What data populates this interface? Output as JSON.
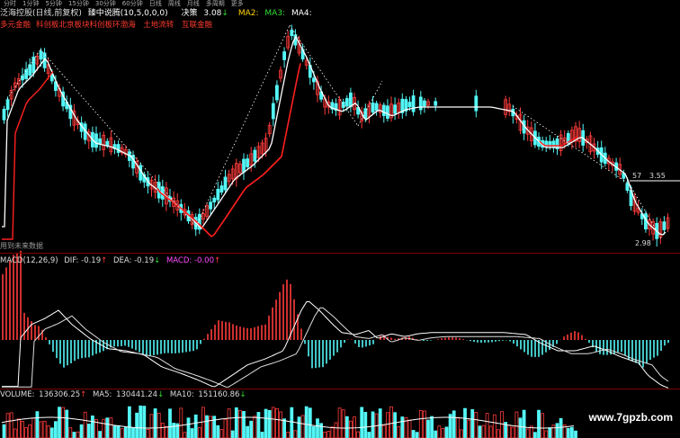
{
  "toolbar": {
    "items": [
      "分时",
      "1分钟",
      "5分钟",
      "15分钟",
      "30分钟",
      "60分钟",
      "日线",
      "周线",
      "月线",
      "多周期",
      "更多"
    ]
  },
  "header": {
    "stock_name": "泛海控股(日线,前复权)",
    "indicator": "臻中说腾(10,5,0,0,0)",
    "decision_label": "决策",
    "decision_value": "3.08",
    "decision_arrow": "↓",
    "ma2": "MA2:",
    "ma3": "MA3:",
    "ma4": "MA4:"
  },
  "concepts": [
    "多元金融",
    "科创板",
    "北京板块",
    "科创板环",
    "渤海",
    "土地流转",
    "互联金融"
  ],
  "main_chart": {
    "price_high_label": "57",
    "price_level_label": "3.55",
    "price_low_label": "2.98",
    "future_data_note": "用到未来数据"
  },
  "macd": {
    "title": "MACD(12,26,9)",
    "dif_label": "DIF:",
    "dif_value": "-0.19",
    "dea_label": "DEA:",
    "dea_value": "-0.19",
    "macd_label": "MACD:",
    "macd_value": "-0.00"
  },
  "volume": {
    "title": "VOLUME:",
    "value": "136306.25",
    "ma5_label": "MA5:",
    "ma5_value": "130441.24",
    "ma10_label": "MA10:",
    "ma10_value": "151160.86"
  },
  "watermark": "www.7gpzb.com",
  "colors": {
    "up": "#ff3b3b",
    "down": "#54f6f6",
    "ma_white": "#ffffff",
    "ma_red": "#ff2020",
    "yellow": "#ffd400",
    "magenta": "#ff4dff",
    "green": "#33dd33"
  }
}
